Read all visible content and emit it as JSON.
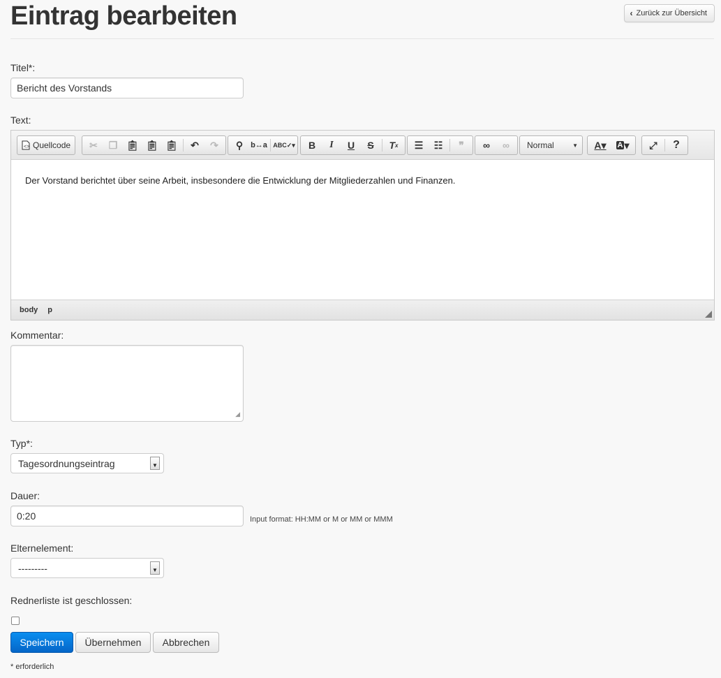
{
  "page": {
    "title": "Eintrag bearbeiten",
    "back_button": "Zurück zur Übersicht"
  },
  "form": {
    "title_label": "Titel*:",
    "title_value": "Bericht des Vorstands",
    "text_label": "Text:",
    "editor": {
      "source_label": "Quellcode",
      "format_value": "Normal",
      "content": "Der Vorstand berichtet über seine Arbeit, insbesondere die Entwicklung der Mitgliederzahlen und Finanzen.",
      "path": [
        "body",
        "p"
      ],
      "toolbar_icons": [
        "source-icon",
        "cut-icon",
        "copy-icon",
        "paste-icon",
        "paste-text-icon",
        "paste-word-icon",
        "undo-icon",
        "redo-icon",
        "find-icon",
        "replace-icon",
        "spellcheck-icon",
        "bold-icon",
        "italic-icon",
        "underline-icon",
        "strike-icon",
        "remove-format-icon",
        "numbered-list-icon",
        "bulleted-list-icon",
        "blockquote-icon",
        "link-icon",
        "unlink-icon",
        "text-color-icon",
        "bg-color-icon",
        "maximize-icon",
        "help-icon"
      ]
    },
    "comment_label": "Kommentar:",
    "comment_value": "",
    "type_label": "Typ*:",
    "type_value": "Tagesordnungseintrag",
    "duration_label": "Dauer:",
    "duration_value": "0:20",
    "duration_help": "Input format: HH:MM or M or MM or MMM",
    "parent_label": "Elternelement:",
    "parent_value": "---------",
    "speakers_closed_label": "Rednerliste ist geschlossen:",
    "speakers_closed_checked": false,
    "buttons": {
      "save": "Speichern",
      "apply": "Übernehmen",
      "cancel": "Abbrechen"
    },
    "required_note": "* erforderlich"
  },
  "colors": {
    "primary": "#0566c8",
    "background": "#f8f8f8"
  }
}
